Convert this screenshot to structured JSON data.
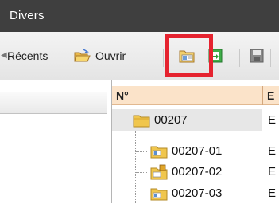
{
  "window": {
    "title": "Divers"
  },
  "toolbar": {
    "recents_label": "Récents",
    "open_label": "Ouvrir",
    "new_folder_icon": "new-folder-icon",
    "green_icon": "green-export-icon",
    "save_icon": "save-icon"
  },
  "highlight": {
    "color": "#e5232f",
    "target": "new-folder-button"
  },
  "grid": {
    "columns": [
      {
        "label": "N°"
      },
      {
        "label": "E"
      }
    ],
    "rows": [
      {
        "id": "00207",
        "etat": "E",
        "level": 0,
        "icon": "folder-icon"
      },
      {
        "id": "00207-01",
        "etat": "E",
        "level": 1,
        "icon": "document-folder-icon"
      },
      {
        "id": "00207-02",
        "etat": "E",
        "level": 1,
        "icon": "locked-folder-icon"
      },
      {
        "id": "00207-03",
        "etat": "E",
        "level": 1,
        "icon": "document-folder-icon"
      }
    ]
  }
}
